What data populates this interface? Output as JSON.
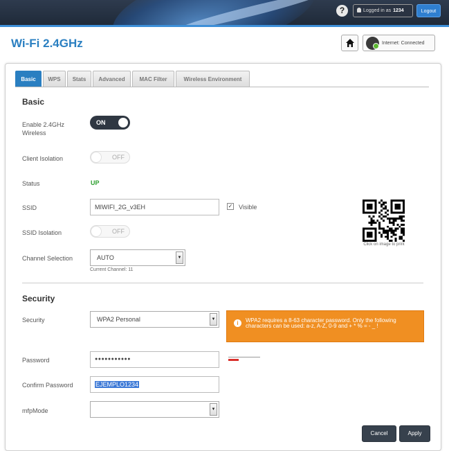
{
  "topbar": {
    "help_symbol": "?",
    "logged_in_label": "Logged in as",
    "user_id": "1234",
    "logout_label": "Logout"
  },
  "header": {
    "title": "Wi-Fi 2.4GHz",
    "internet_label": "Internet:",
    "internet_status": "Connected"
  },
  "tabs": [
    {
      "label": "Basic",
      "active": true
    },
    {
      "label": "WPS",
      "active": false
    },
    {
      "label": "Stats",
      "active": false
    },
    {
      "label": "Advanced",
      "active": false
    },
    {
      "label": "MAC Filter",
      "active": false
    },
    {
      "label": "Wireless Environment",
      "active": false
    }
  ],
  "basic": {
    "section_title": "Basic",
    "enable_label": "Enable 2.4GHz Wireless",
    "enable_value": "ON",
    "client_isolation_label": "Client Isolation",
    "client_isolation_value": "OFF",
    "status_label": "Status",
    "status_value": "UP",
    "ssid_label": "SSID",
    "ssid_value": "MIWIFI_2G_v3EH",
    "visible_label": "Visible",
    "visible_checked": "✓",
    "ssid_isolation_label": "SSID Isolation",
    "ssid_isolation_value": "OFF",
    "channel_label": "Channel Selection",
    "channel_value": "AUTO",
    "current_channel": "Current Channel: 11",
    "qr_caption": "Click on image to print"
  },
  "security": {
    "section_title": "Security",
    "security_label": "Security",
    "security_value": "WPA2 Personal",
    "warning_text": "WPA2 requires a 8-63 character password. Only the following characters can be used: a-z, A-Z, 0-9 and + * % = - _ !",
    "password_label": "Password",
    "password_value": "●●●●●●●●●●●",
    "confirm_label": "Confirm Password",
    "confirm_value": "EJEMPLO1234",
    "mfp_label": "mfpMode",
    "mfp_value": ""
  },
  "actions": {
    "cancel_label": "Cancel",
    "apply_label": "Apply"
  },
  "colors": {
    "accent": "#2a7fc1",
    "status_up": "#2ea030",
    "warning": "#f08f22"
  }
}
